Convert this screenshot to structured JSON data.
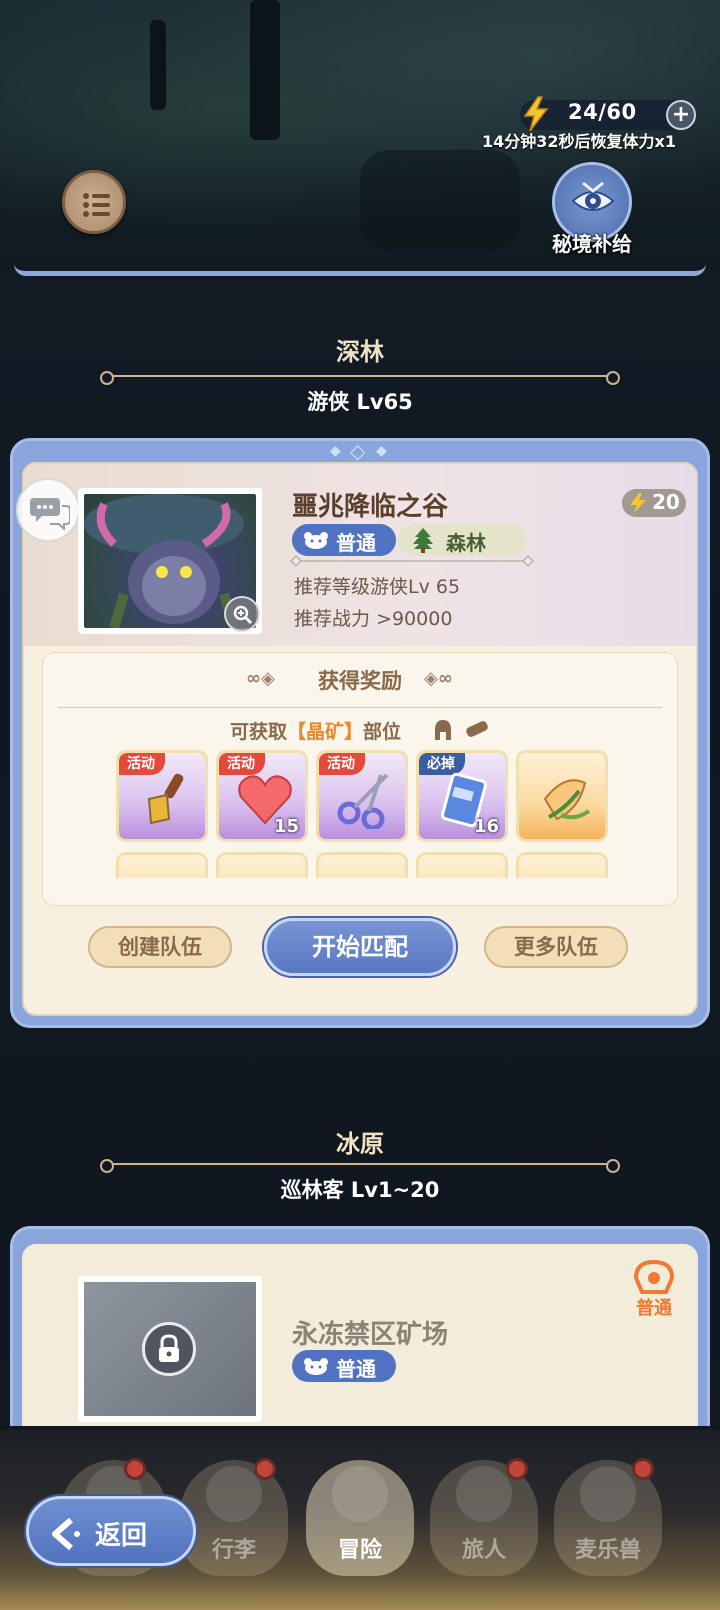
{
  "header": {
    "stamina_value": "24/60",
    "stamina_plus": "+",
    "regen_text": "14分钟32秒后恢复体力x1",
    "secret_supply_label": "秘境补给"
  },
  "section1": {
    "title": "深林",
    "subtitle": "游侠 Lv65"
  },
  "dungeon1": {
    "name": "噩兆降临之谷",
    "energy_cost": "20",
    "difficulty_tag": "普通",
    "terrain_tag": "森林",
    "rec_level": "推荐等级游侠Lv 65",
    "rec_power": "推荐战力 >90000"
  },
  "rewards": {
    "title": "获得奖励",
    "obtain_prefix": "可获取",
    "obtain_highlight": "【晶矿】",
    "obtain_suffix": "部位",
    "items": [
      {
        "tag": "活动",
        "count": "",
        "icon": "spatula-icon"
      },
      {
        "tag": "活动",
        "count": "15",
        "icon": "heart-icon"
      },
      {
        "tag": "活动",
        "count": "",
        "icon": "scissors-icon"
      },
      {
        "tag": "必掉",
        "count": "16",
        "icon": "ticket-icon"
      },
      {
        "tag": "",
        "count": "",
        "icon": "crystal-leaf-icon"
      }
    ]
  },
  "actions": {
    "create_team": "创建队伍",
    "start_match": "开始匹配",
    "more_teams": "更多队伍"
  },
  "section2": {
    "title": "冰原",
    "subtitle": "巡林客 Lv1~20"
  },
  "dungeon2": {
    "name": "永冻禁区矿场",
    "difficulty_tag": "普通",
    "badge_label": "普通"
  },
  "nav": {
    "items": [
      "行李",
      "冒险",
      "旅人",
      "麦乐兽"
    ],
    "back_label": "返回"
  },
  "colors": {
    "accent_blue": "#5a78c2",
    "card_bg": "#f7efe0",
    "highlight_orange": "#e58a2e",
    "activity_red": "#e5493c"
  }
}
